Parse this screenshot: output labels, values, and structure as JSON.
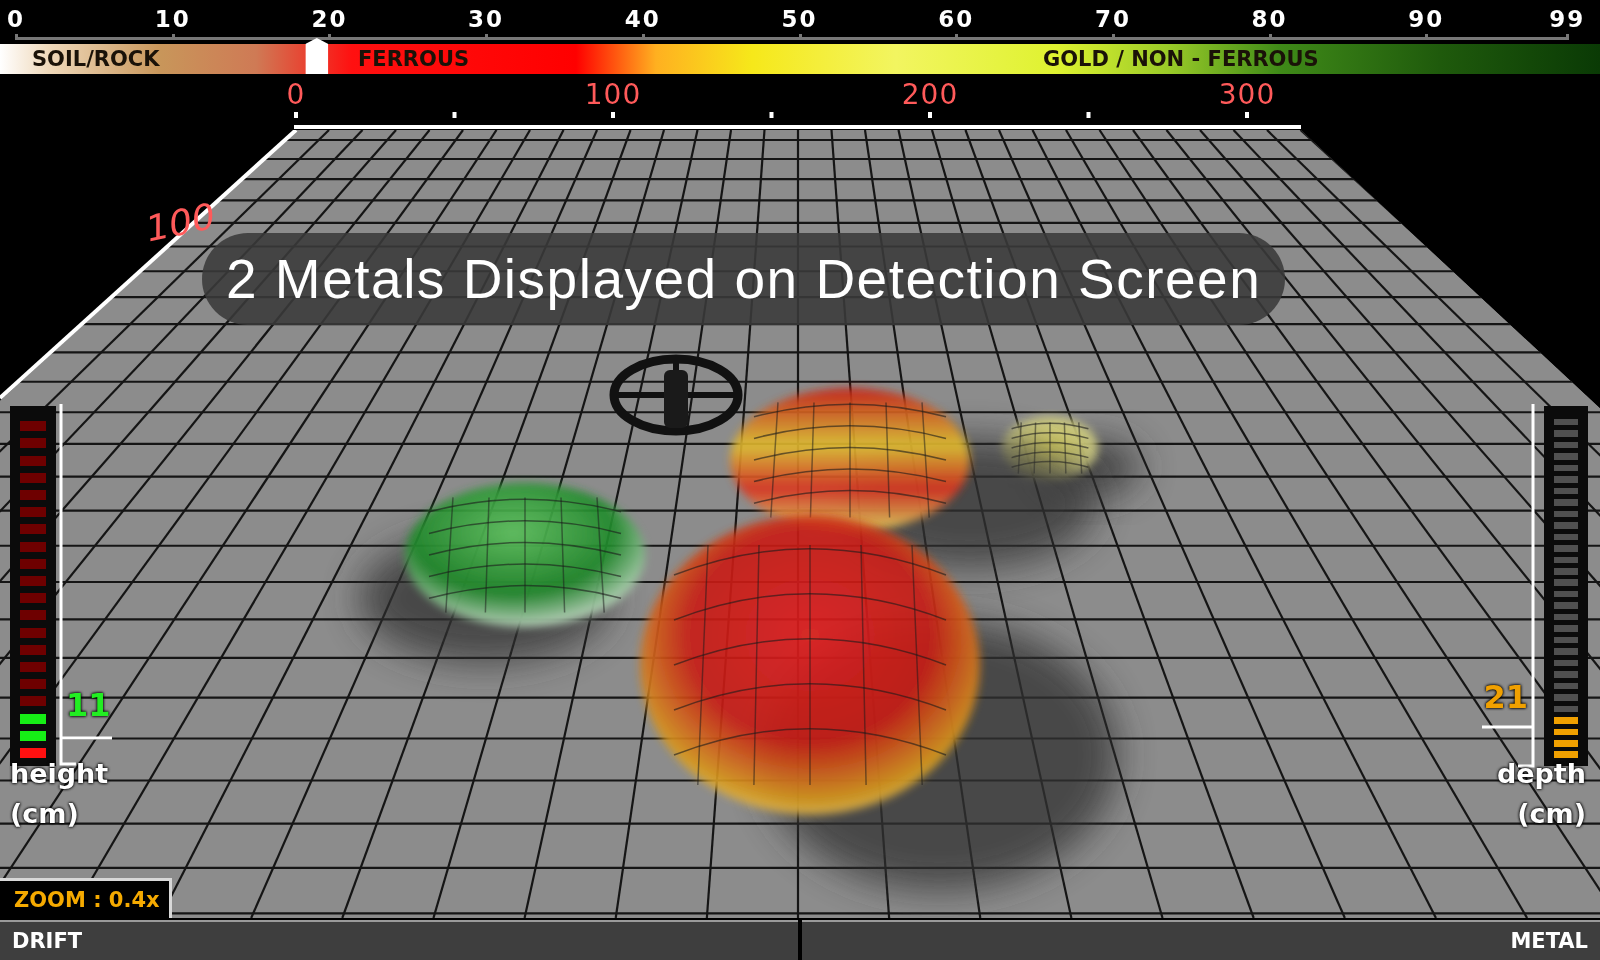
{
  "scale": {
    "ticks": [
      "0",
      "10",
      "20",
      "30",
      "40",
      "50",
      "60",
      "70",
      "80",
      "90",
      "99"
    ]
  },
  "spectrum": {
    "zones": [
      {
        "label": "SOIL/ROCK"
      },
      {
        "label": "FERROUS"
      },
      {
        "label": "GOLD / NON - FERROUS"
      }
    ],
    "pointer": {
      "level": 0.198
    }
  },
  "distance_scale": {
    "ticks": [
      "0",
      "100",
      "200",
      "300"
    ]
  },
  "side_scale_label": "100",
  "caption": "2 Metals Displayed on Detection Screen",
  "meters": [
    {
      "kind": "height",
      "level": 0.15,
      "reading": "11",
      "label": "height",
      "unit": "(cm)"
    },
    {
      "kind": "depth",
      "level": 0.1333,
      "reading": "21",
      "label": "depth",
      "unit": "(cm)"
    }
  ],
  "zoom_label": "ZOOM : 0.4x",
  "status_bar": {
    "left": "DRIFT",
    "right": "METAL"
  }
}
